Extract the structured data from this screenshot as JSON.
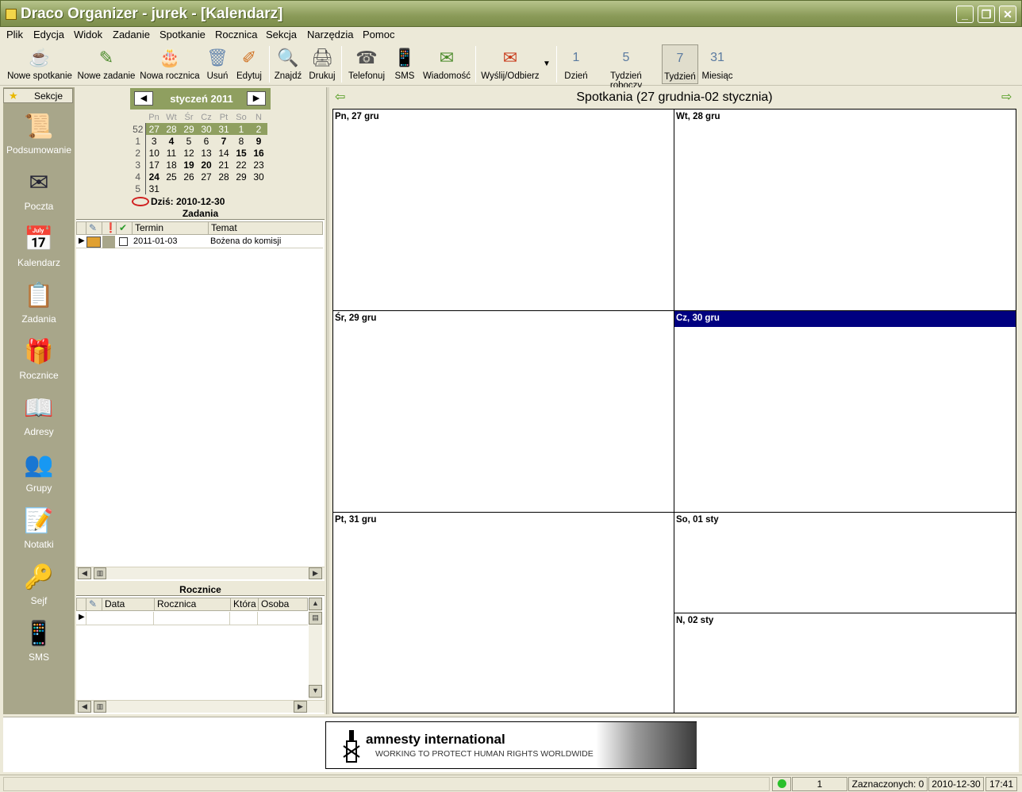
{
  "window": {
    "title": "Draco Organizer - jurek - [Kalendarz]"
  },
  "menu": [
    "Plik",
    "Edycja",
    "Widok",
    "Zadanie",
    "Spotkanie",
    "Rocznica",
    "Sekcja",
    "Narzędzia",
    "Pomoc"
  ],
  "toolbar": {
    "new_meeting": "Nowe spotkanie",
    "new_task": "Nowe zadanie",
    "new_anniversary": "Nowa rocznica",
    "delete": "Usuń",
    "edit": "Edytuj",
    "find": "Znajdź",
    "print": "Drukuj",
    "call": "Telefonuj",
    "sms": "SMS",
    "message": "Wiadomość",
    "send_receive": "Wyślij/Odbierz",
    "day": "Dzień",
    "work_week": "Tydzień roboczy",
    "week": "Tydzień",
    "month": "Miesiąc"
  },
  "sections": {
    "header": "Sekcje",
    "items": [
      "Podsumowanie",
      "Poczta",
      "Kalendarz",
      "Zadania",
      "Rocznice",
      "Adresy",
      "Grupy",
      "Notatki",
      "Sejf",
      "SMS"
    ]
  },
  "mini_calendar": {
    "title": "styczeń 2011",
    "dow": [
      "Pn",
      "Wt",
      "Śr",
      "Cz",
      "Pt",
      "So",
      "N"
    ],
    "weeks": [
      {
        "wk": "52",
        "days": [
          "27",
          "28",
          "29",
          "30",
          "31",
          "1",
          "2"
        ]
      },
      {
        "wk": "1",
        "days": [
          "3",
          "4",
          "5",
          "6",
          "7",
          "8",
          "9"
        ]
      },
      {
        "wk": "2",
        "days": [
          "10",
          "11",
          "12",
          "13",
          "14",
          "15",
          "16"
        ]
      },
      {
        "wk": "3",
        "days": [
          "17",
          "18",
          "19",
          "20",
          "21",
          "22",
          "23"
        ]
      },
      {
        "wk": "4",
        "days": [
          "24",
          "25",
          "26",
          "27",
          "28",
          "29",
          "30"
        ]
      },
      {
        "wk": "5",
        "days": [
          "31"
        ]
      }
    ],
    "today_label": "Dziś: 2010-12-30"
  },
  "tasks": {
    "title": "Zadania",
    "columns": [
      "Termin",
      "Temat"
    ],
    "rows": [
      {
        "due": "2011-01-03",
        "subject": "Bożena do komisji"
      }
    ]
  },
  "anniversaries": {
    "title": "Rocznice",
    "columns": [
      "Data",
      "Rocznica",
      "Która",
      "Osoba"
    ]
  },
  "week_view": {
    "title": "Spotkania (27 grudnia-02 stycznia)",
    "days": [
      "Pn, 27 gru",
      "Wt, 28 gru",
      "Śr, 29 gru",
      "Cz, 30 gru",
      "Pt, 31 gru",
      "So, 01 sty",
      "N, 02 sty"
    ]
  },
  "banner": {
    "name": "amnesty international",
    "tagline": "WORKING TO PROTECT HUMAN RIGHTS WORLDWIDE"
  },
  "status": {
    "count": "1",
    "selected": "Zaznaczonych: 0",
    "date": "2010-12-30",
    "time": "17:41"
  }
}
